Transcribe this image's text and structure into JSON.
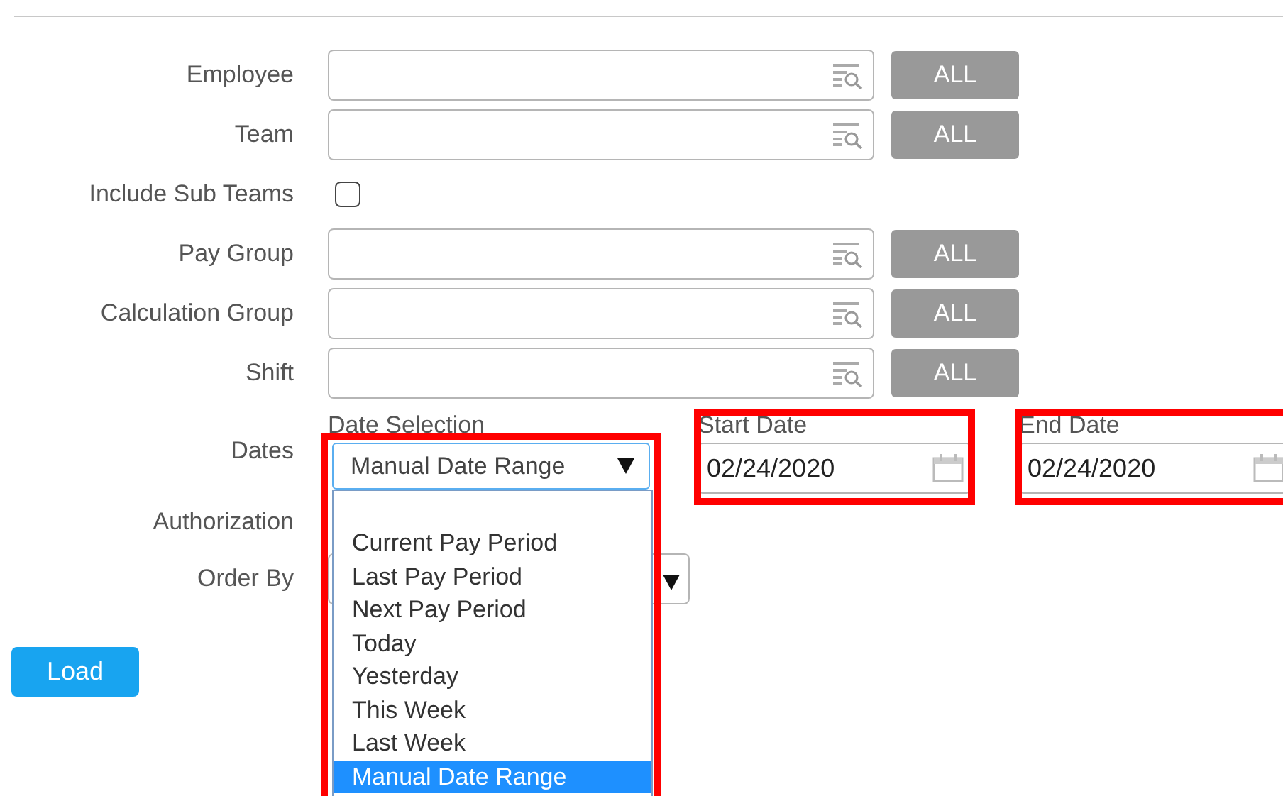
{
  "filters": [
    {
      "kind": "lookup",
      "label": "Employee",
      "button": "ALL"
    },
    {
      "kind": "lookup",
      "label": "Team",
      "button": "ALL"
    },
    {
      "kind": "checkbox",
      "label": "Include Sub Teams",
      "checked": false
    },
    {
      "kind": "lookup",
      "label": "Pay Group",
      "button": "ALL"
    },
    {
      "kind": "lookup",
      "label": "Calculation Group",
      "button": "ALL"
    },
    {
      "kind": "lookup",
      "label": "Shift",
      "button": "ALL"
    }
  ],
  "dates": {
    "label": "Dates",
    "date_selection": {
      "label": "Date Selection",
      "value": "Manual Date Range",
      "highlighted": true,
      "expanded": true,
      "options": [
        {
          "label": "Current Pay Period",
          "selected": false
        },
        {
          "label": "Last Pay Period",
          "selected": false
        },
        {
          "label": "Next Pay Period",
          "selected": false
        },
        {
          "label": "Today",
          "selected": false
        },
        {
          "label": "Yesterday",
          "selected": false
        },
        {
          "label": "This Week",
          "selected": false
        },
        {
          "label": "Last Week",
          "selected": false
        },
        {
          "label": "Manual Date Range",
          "selected": true
        }
      ]
    },
    "start_date": {
      "label": "Start Date",
      "value": "02/24/2020",
      "highlighted": true
    },
    "end_date": {
      "label": "End Date",
      "value": "02/24/2020",
      "highlighted": true
    }
  },
  "authorization": {
    "label": "Authorization"
  },
  "order_by": {
    "label": "Order By"
  },
  "load_button": "Load"
}
